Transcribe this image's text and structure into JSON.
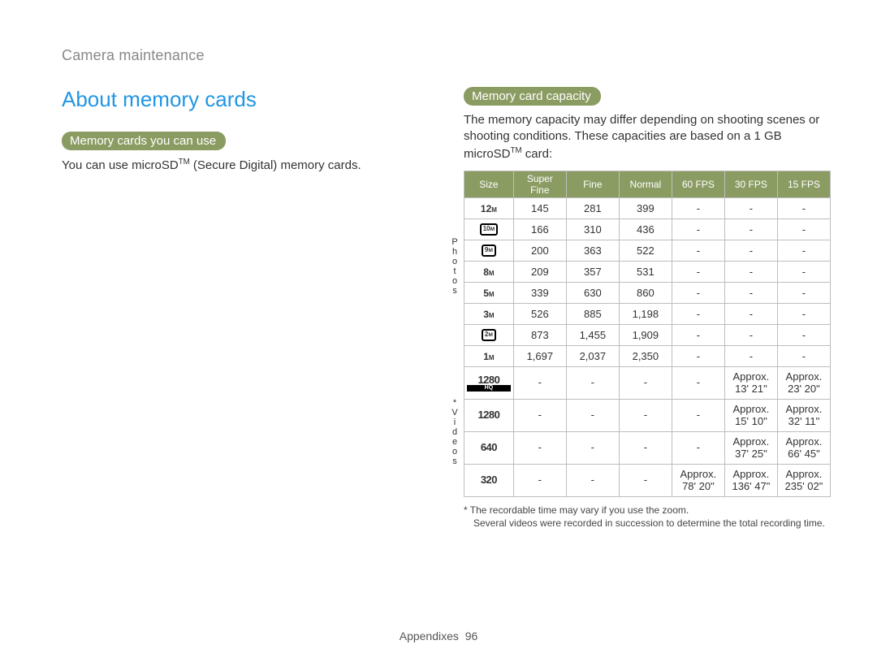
{
  "breadcrumb": "Camera maintenance",
  "heading": "About memory cards",
  "left": {
    "pill": "Memory cards you can use",
    "body_pre": "You can use microSD",
    "body_sup": "TM",
    "body_post": " (Secure Digital) memory cards."
  },
  "right": {
    "pill": "Memory card capacity",
    "body_pre": "The memory capacity may differ depending on shooting scenes or shooting conditions. These capacities are based on a 1 GB microSD",
    "body_sup": "TM",
    "body_post": " card:"
  },
  "table": {
    "headers": [
      "Size",
      "Super Fine",
      "Fine",
      "Normal",
      "60 FPS",
      "30 FPS",
      "15 FPS"
    ],
    "group_photos": "Photos",
    "group_videos": "*Videos",
    "photo_rows": [
      {
        "size_label": "12",
        "size_sub": "M",
        "cells": [
          "145",
          "281",
          "399",
          "-",
          "-",
          "-"
        ]
      },
      {
        "size_label": "10",
        "size_sub": "M",
        "boxed": true,
        "cells": [
          "166",
          "310",
          "436",
          "-",
          "-",
          "-"
        ]
      },
      {
        "size_label": "9",
        "size_sub": "M",
        "boxed": true,
        "cells": [
          "200",
          "363",
          "522",
          "-",
          "-",
          "-"
        ]
      },
      {
        "size_label": "8",
        "size_sub": "M",
        "cells": [
          "209",
          "357",
          "531",
          "-",
          "-",
          "-"
        ]
      },
      {
        "size_label": "5",
        "size_sub": "M",
        "cells": [
          "339",
          "630",
          "860",
          "-",
          "-",
          "-"
        ]
      },
      {
        "size_label": "3",
        "size_sub": "M",
        "cells": [
          "526",
          "885",
          "1,198",
          "-",
          "-",
          "-"
        ]
      },
      {
        "size_label": "2",
        "size_sub": "M",
        "boxed": true,
        "cells": [
          "873",
          "1,455",
          "1,909",
          "-",
          "-",
          "-"
        ]
      },
      {
        "size_label": "1",
        "size_sub": "M",
        "cells": [
          "1,697",
          "2,037",
          "2,350",
          "-",
          "-",
          "-"
        ]
      }
    ],
    "video_rows": [
      {
        "size_label": "1280",
        "hq": true,
        "cells": [
          "-",
          "-",
          "-",
          "-",
          "Approx. 13' 21\"",
          "Approx. 23' 20\""
        ]
      },
      {
        "size_label": "1280",
        "cells": [
          "-",
          "-",
          "-",
          "-",
          "Approx. 15' 10\"",
          "Approx. 32' 11\""
        ]
      },
      {
        "size_label": "640",
        "cells": [
          "-",
          "-",
          "-",
          "-",
          "Approx. 37' 25\"",
          "Approx. 66' 45\""
        ]
      },
      {
        "size_label": "320",
        "cells": [
          "-",
          "-",
          "-",
          "Approx. 78' 20\"",
          "Approx. 136' 47\"",
          "Approx. 235' 02\""
        ]
      }
    ]
  },
  "footnote_star": "*",
  "footnote_line1": " The recordable time may vary if you use the zoom.",
  "footnote_line2": "Several videos were recorded in succession to determine the total recording time.",
  "footer_section": "Appendixes",
  "footer_page": "96"
}
